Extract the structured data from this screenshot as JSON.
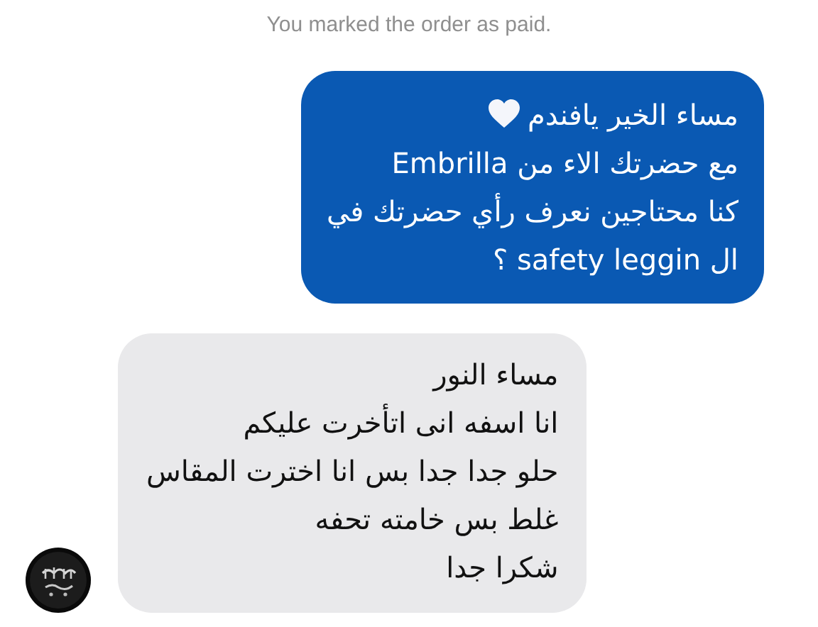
{
  "status_text": "You marked the order as paid.",
  "messages": [
    {
      "kind": "outgoing",
      "lines": [
        {
          "kind": "emoji",
          "text": "مساء الخير يافندم"
        },
        {
          "kind": "plain",
          "text": "مع حضرتك الاء من Embrilla"
        },
        {
          "kind": "plain",
          "text": "كنا محتاجين نعرف رأي حضرتك في"
        },
        {
          "kind": "plain",
          "text": "ال safety leggin ؟"
        }
      ]
    },
    {
      "kind": "incoming",
      "lines": [
        {
          "kind": "plain",
          "text": "مساء النور"
        },
        {
          "kind": "plain",
          "text": "انا اسفه انى اتأخرت عليكم"
        },
        {
          "kind": "plain",
          "text": "حلو جدا جدا بس انا اخترت المقاس"
        },
        {
          "kind": "plain",
          "text": "غلط بس خامته تحفه"
        },
        {
          "kind": "plain",
          "text": "شكرا جدا"
        }
      ]
    }
  ]
}
